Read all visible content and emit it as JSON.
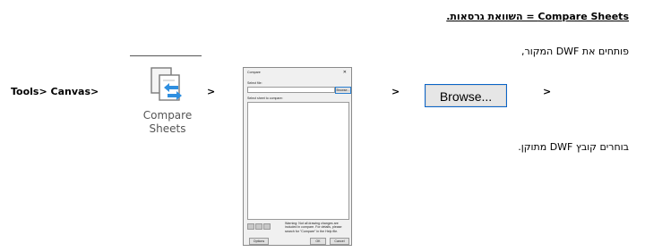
{
  "heading": "Compare Sheets = השוואת גרסאות.",
  "step1_text": "פותחים את DWF המקור,",
  "step2_text": "בוחרים קובץ  DWF מתוקן.",
  "path_text": "Tools> Canvas>",
  "arrow": ">",
  "compare_button": {
    "label_line1": "Compare",
    "label_line2": "Sheets",
    "icon": "compare-sheets-icon"
  },
  "browse_button": {
    "label": "Browse..."
  },
  "dialog": {
    "title": "Compare",
    "select_file_label": "Select file:",
    "browse_label": "Browse...",
    "select_sheet_label": "Select sheet to compare:",
    "warning": "Warning: Not all drawing changes are included in compare. For details, please search for \"Compare\" in the Help file.",
    "options_label": "Options",
    "ok_label": "OK",
    "cancel_label": "Cancel"
  }
}
